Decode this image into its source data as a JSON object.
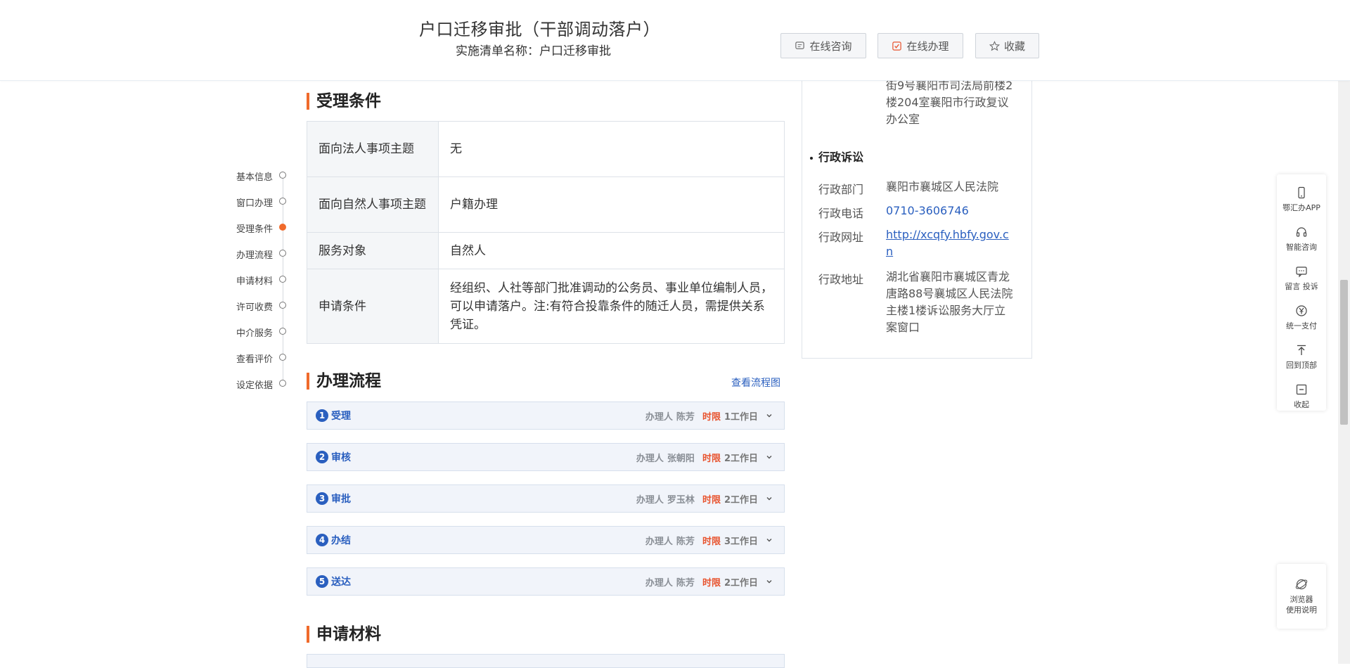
{
  "header": {
    "title": "户口迁移审批（干部调动落户）",
    "subtitle": "实施清单名称：户口迁移审批",
    "buttons": {
      "consult": "在线咨询",
      "handle": "在线办理",
      "favorite": "收藏"
    }
  },
  "left_nav": {
    "items": [
      "基本信息",
      "窗口办理",
      "受理条件",
      "办理流程",
      "申请材料",
      "许可收费",
      "中介服务",
      "查看评价",
      "设定依据"
    ],
    "active": "受理条件"
  },
  "conditions": {
    "title": "受理条件",
    "rows": [
      {
        "key": "面向法人事项主题",
        "value": "无"
      },
      {
        "key": "面向自然人事项主题",
        "value": "户籍办理"
      },
      {
        "key": "服务对象",
        "value": "自然人"
      },
      {
        "key": "申请条件",
        "value": "经组织、人社等部门批准调动的公务员、事业单位编制人员，可以申请落户。注:有符合投靠条件的随迁人员，需提供关系凭证。"
      }
    ]
  },
  "flow": {
    "title": "办理流程",
    "view_chart_link": "查看流程图",
    "handler_label": "办理人",
    "limit_label": "时限",
    "steps": [
      {
        "num": "1",
        "name": "受理",
        "person": "陈芳",
        "days": "1工作日"
      },
      {
        "num": "2",
        "name": "审核",
        "person": "张朝阳",
        "days": "2工作日"
      },
      {
        "num": "3",
        "name": "审批",
        "person": "罗玉林",
        "days": "2工作日"
      },
      {
        "num": "4",
        "name": "办结",
        "person": "陈芳",
        "days": "3工作日"
      },
      {
        "num": "5",
        "name": "送达",
        "person": "陈芳",
        "days": "2工作日"
      }
    ]
  },
  "materials": {
    "title": "申请材料"
  },
  "right_card": {
    "review_address_tail": "街9号襄阳市司法局前楼2楼204室襄阳市行政复议办公室",
    "litigation_title": "行政诉讼",
    "litigation": [
      {
        "label": "行政部门",
        "value": "襄阳市襄城区人民法院"
      },
      {
        "label": "行政电话",
        "value": "0710-3606746"
      },
      {
        "label": "行政网址",
        "value": "http://xcqfy.hbfy.gov.cn"
      },
      {
        "label": "行政地址",
        "value": "湖北省襄阳市襄城区青龙唐路88号襄城区人民法院主楼1楼诉讼服务大厅立案窗口"
      }
    ]
  },
  "toolbar": {
    "app": "鄂汇办APP",
    "ai": "智能咨询",
    "msg": "留言 投诉",
    "pay": "统一支付",
    "top": "回到顶部",
    "collapse": "收起",
    "browser_line1": "浏览器",
    "browser_line2": "使用说明"
  },
  "colors": {
    "accent": "#f06a2b",
    "link": "#2a5fbf",
    "limit": "#e8542f"
  }
}
